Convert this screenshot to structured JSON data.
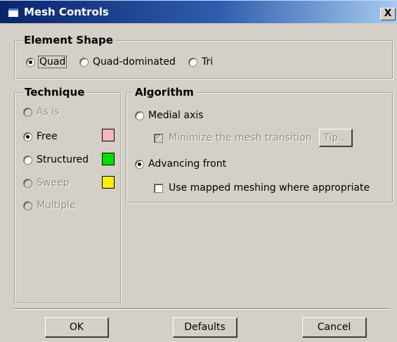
{
  "window": {
    "title": "Mesh Controls",
    "close_label": "X"
  },
  "element_shape": {
    "legend": "Element Shape",
    "options": [
      {
        "label": "Quad",
        "checked": true
      },
      {
        "label": "Quad-dominated",
        "checked": false
      },
      {
        "label": "Tri",
        "checked": false
      }
    ]
  },
  "technique": {
    "legend": "Technique",
    "options": [
      {
        "label": "As is",
        "checked": false,
        "enabled": false
      },
      {
        "label": "Free",
        "checked": true,
        "enabled": true,
        "swatch": "#f4b6c2"
      },
      {
        "label": "Structured",
        "checked": false,
        "enabled": true,
        "swatch": "#00e000"
      },
      {
        "label": "Sweep",
        "checked": false,
        "enabled": false,
        "swatch": "#f8f000"
      },
      {
        "label": "Multiple",
        "checked": false,
        "enabled": false
      }
    ]
  },
  "algorithm": {
    "legend": "Algorithm",
    "medial_axis": "Medial axis",
    "minimize_transition": "Minimize the mesh transition",
    "tip_label": "Tip...",
    "advancing_front": "Advancing front",
    "mapped_meshing": "Use mapped meshing where appropriate"
  },
  "buttons": {
    "ok": "OK",
    "defaults": "Defaults",
    "cancel": "Cancel"
  }
}
